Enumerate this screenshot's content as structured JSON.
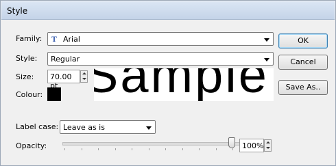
{
  "window": {
    "title": "Style"
  },
  "family": {
    "label": "Family:",
    "value": "Arial",
    "icon": "font-icon"
  },
  "style": {
    "label": "Style:",
    "value": "Regular"
  },
  "size": {
    "label": "Size:",
    "value": "70.00 pt"
  },
  "colour": {
    "label": "Colour:",
    "swatch": "#000000"
  },
  "preview": {
    "text": "Sample"
  },
  "buttons": {
    "ok": "OK",
    "cancel": "Cancel",
    "save_as": "Save As.."
  },
  "label_case": {
    "label": "Label case:",
    "value": "Leave as is"
  },
  "opacity": {
    "label": "Opacity:",
    "value": "100%",
    "level": 1.0
  }
}
